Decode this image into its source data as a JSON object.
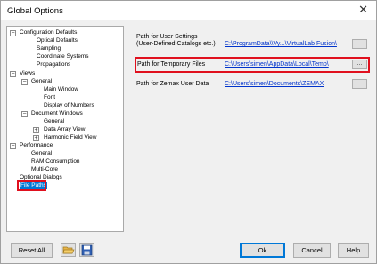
{
  "window": {
    "title": "Global Options",
    "close_glyph": "✕"
  },
  "tree": {
    "toggle_minus": "−",
    "toggle_plus": "+",
    "items": {
      "configuration_defaults": "Configuration Defaults",
      "optical_defaults": "Optical Defaults",
      "sampling": "Sampling",
      "coordinate_systems": "Coordinate Systems",
      "propagations": "Propagations",
      "views": "Views",
      "general": "General",
      "main_window": "Main Window",
      "font": "Font",
      "display_of_numbers": "Display of Numbers",
      "document_windows": "Document Windows",
      "doc_general": "General",
      "data_array_view": "Data Array View",
      "harmonic_field_view": "Harmonic Field View",
      "performance": "Performance",
      "perf_general": "General",
      "ram_consumption": "RAM Consumption",
      "multi_core": "Multi-Core",
      "optional_dialogs": "Optional Dialogs",
      "file_paths": "File Paths"
    },
    "selected": "file_paths"
  },
  "settings": {
    "user_settings": {
      "label_line1": "Path for User Settings",
      "label_line2": "(User-Defined Catalogs etc.)",
      "path": "C:\\ProgramData\\\\Vy...\\VirtualLab Fusion\\",
      "browse_label": "..."
    },
    "temporary_files": {
      "label": "Path for Temporary Files",
      "path": "C:\\Users\\simen\\AppData\\Local\\Temp\\",
      "browse_label": "..."
    },
    "zemax_user_data": {
      "label": "Path for Zemax User Data",
      "path": "C:\\Users\\simen\\Documents\\ZEMAX",
      "browse_label": "..."
    }
  },
  "footer": {
    "reset_all": "Reset All",
    "ok": "Ok",
    "cancel": "Cancel",
    "help": "Help",
    "open_icon": "folder-open-icon",
    "save_icon": "floppy-disk-icon"
  },
  "colors": {
    "highlight_red": "#e0101e",
    "selection_blue": "#0078d7",
    "link_blue": "#0033cc"
  }
}
